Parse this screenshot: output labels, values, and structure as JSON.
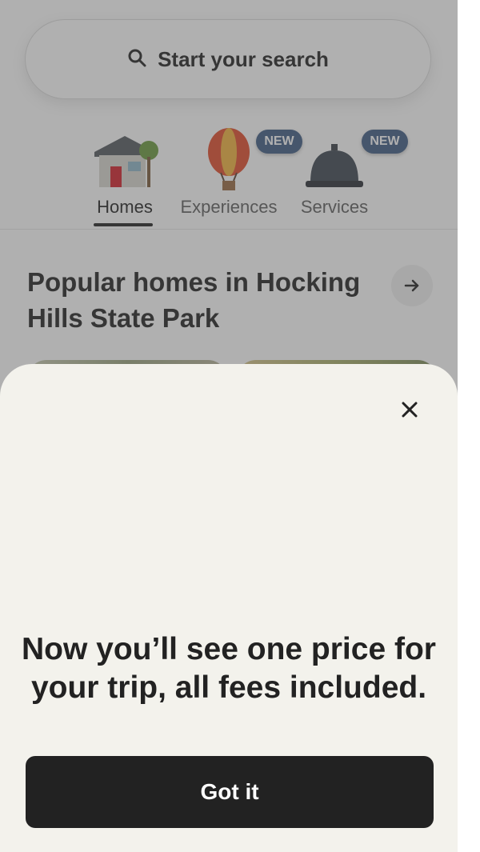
{
  "search": {
    "placeholder": "Start your search"
  },
  "categories": [
    {
      "label": "Homes",
      "selected": true,
      "icon": "house-icon"
    },
    {
      "label": "Experiences",
      "badge": "NEW",
      "icon": "hot-air-balloon-icon"
    },
    {
      "label": "Services",
      "badge": "NEW",
      "icon": "service-bell-icon"
    }
  ],
  "section": {
    "title": "Popular homes in Hocking Hills State Park",
    "arrow_icon": "arrow-right-icon"
  },
  "modal": {
    "title": "Now you’ll see one price for your trip, all fees included.",
    "button_label": "Got it",
    "close_icon": "close-icon"
  },
  "colors": {
    "badge": "#3e5b84",
    "button": "#222222",
    "sheet": "#f3f2ec"
  }
}
